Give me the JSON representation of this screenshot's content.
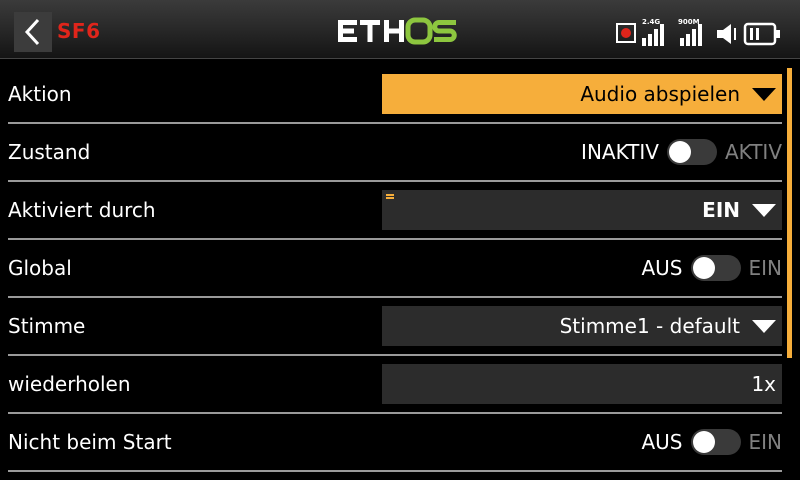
{
  "header": {
    "title": "SF6",
    "logo": "ETHOS",
    "signal_24": "2.4G",
    "signal_900": "900M"
  },
  "rows": {
    "aktion": {
      "label": "Aktion",
      "value": "Audio abspielen"
    },
    "zustand": {
      "label": "Zustand",
      "off": "INAKTIV",
      "on": "AKTIV"
    },
    "aktiviert": {
      "label": "Aktiviert durch",
      "value": "EIN"
    },
    "global": {
      "label": "Global",
      "off": "AUS",
      "on": "EIN"
    },
    "stimme": {
      "label": "Stimme",
      "value": "Stimme1 - default"
    },
    "wiederholen": {
      "label": "wiederholen",
      "value": "1x"
    },
    "nicht_start": {
      "label": "Nicht beim Start",
      "off": "AUS",
      "on": "EIN"
    }
  },
  "colors": {
    "accent": "#f6ae3b",
    "title_red": "#e0251b",
    "logo_green": "#8dc63f"
  },
  "icons": [
    "back-chevron-icon",
    "record-icon",
    "signal-2.4g-icon",
    "signal-900m-icon",
    "speaker-icon",
    "battery-icon",
    "dropdown-caret-icon",
    "menu-lines-icon"
  ]
}
